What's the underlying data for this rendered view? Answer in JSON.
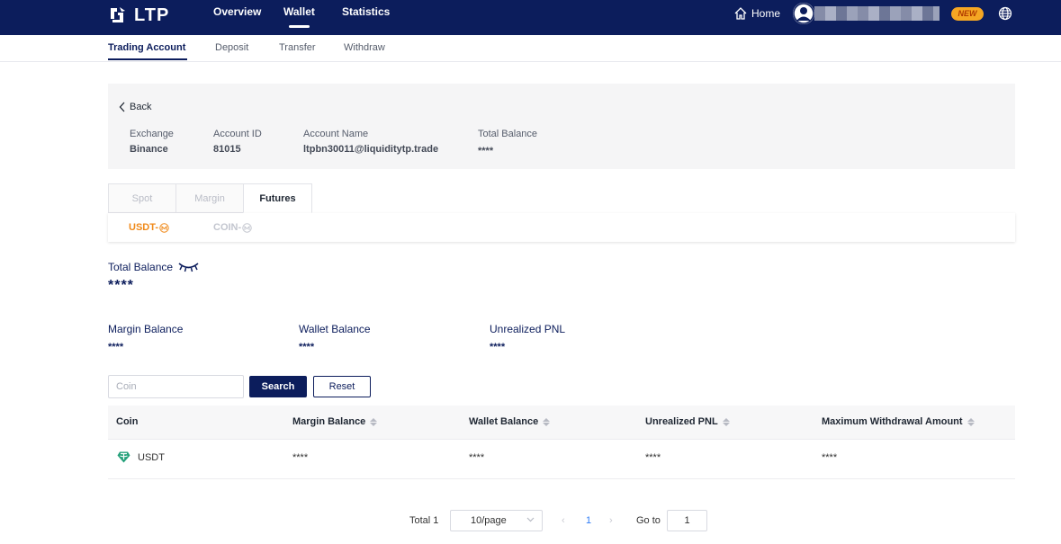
{
  "topnav": {
    "logo_text": "LTP",
    "links": [
      "Overview",
      "Wallet",
      "Statistics"
    ],
    "active_link": "Wallet",
    "home_label": "Home",
    "new_badge": "NEW",
    "logo_icon": "ltp-logo-icon",
    "home_icon": "home-icon",
    "avatar_icon": "user-avatar-icon",
    "globe_icon": "globe-icon",
    "bg_color": "#0c1d5c"
  },
  "subnav": {
    "items": [
      "Trading Account",
      "Deposit",
      "Transfer",
      "Withdraw"
    ],
    "active": "Trading Account"
  },
  "account": {
    "back_label": "Back",
    "fields": [
      {
        "label": "Exchange",
        "value": "Binance"
      },
      {
        "label": "Account ID",
        "value": "81015"
      },
      {
        "label": "Account Name",
        "value": "ltpbn30011@liquiditytp.trade"
      },
      {
        "label": "Total Balance",
        "value": "****"
      }
    ]
  },
  "account_tabs": {
    "items": [
      "Spot",
      "Margin",
      "Futures"
    ],
    "active": "Futures"
  },
  "futures_tabs": {
    "items": [
      "USDT-",
      "COIN-"
    ],
    "active": "USDT-",
    "suffix_icon": "m-circle-icon"
  },
  "balances": {
    "total_label": "Total Balance",
    "total_value": "****",
    "eye_icon": "eye-closed-icon",
    "items": [
      {
        "label": "Margin Balance",
        "value": "****"
      },
      {
        "label": "Wallet Balance",
        "value": "****"
      },
      {
        "label": "Unrealized PNL",
        "value": "****"
      }
    ]
  },
  "search": {
    "placeholder": "Coin",
    "value": "",
    "search_label": "Search",
    "reset_label": "Reset"
  },
  "table": {
    "columns": [
      "Coin",
      "Margin Balance",
      "Wallet Balance",
      "Unrealized PNL",
      "Maximum Withdrawal Amount"
    ],
    "rows": [
      {
        "coin": "USDT",
        "coin_icon": "tether-icon",
        "margin_balance": "****",
        "wallet_balance": "****",
        "unrealized_pnl": "****",
        "max_withdrawal": "****"
      }
    ]
  },
  "pagination": {
    "total": "Total 1",
    "page_size": "10/page",
    "current_page": "1",
    "goto_label": "Go to",
    "goto_value": "1"
  },
  "colors": {
    "primary": "#0c1d5c",
    "accent": "#f08a1a",
    "link": "#2f7cf6",
    "tether": "#26a17b"
  }
}
